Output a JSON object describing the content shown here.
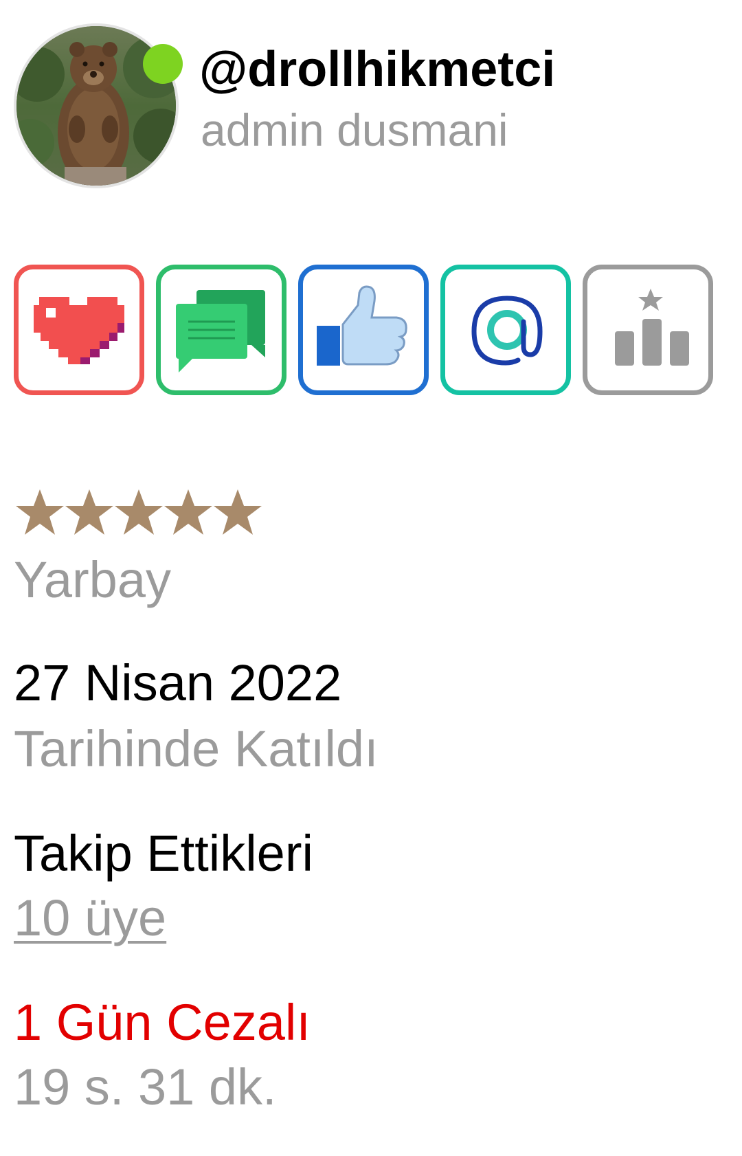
{
  "profile": {
    "username": "@drollhikmetci",
    "title": "admin dusmani",
    "online": true,
    "online_color": "#7ed321",
    "avatar_icon": "bear-photo-avatar"
  },
  "badges": [
    {
      "icon": "heart-icon",
      "border_color": "#f05552"
    },
    {
      "icon": "chat-bubbles-icon",
      "border_color": "#2ebd6b"
    },
    {
      "icon": "thumbs-up-icon",
      "border_color": "#1f6fd1"
    },
    {
      "icon": "at-sign-icon",
      "border_color": "#14c2a3"
    },
    {
      "icon": "leaderboard-icon",
      "border_color": "#9b9b9b"
    }
  ],
  "rank": {
    "stars": 5,
    "star_color": "#a88a6a",
    "label": "Yarbay"
  },
  "joined": {
    "date": "27 Nisan 2022",
    "label": "Tarihinde Katıldı"
  },
  "following": {
    "label": "Takip Ettikleri",
    "value": "10 üye"
  },
  "penalty": {
    "label": "1 Gün Cezalı",
    "remaining": "19 s. 31 dk.",
    "color": "#e20000"
  }
}
